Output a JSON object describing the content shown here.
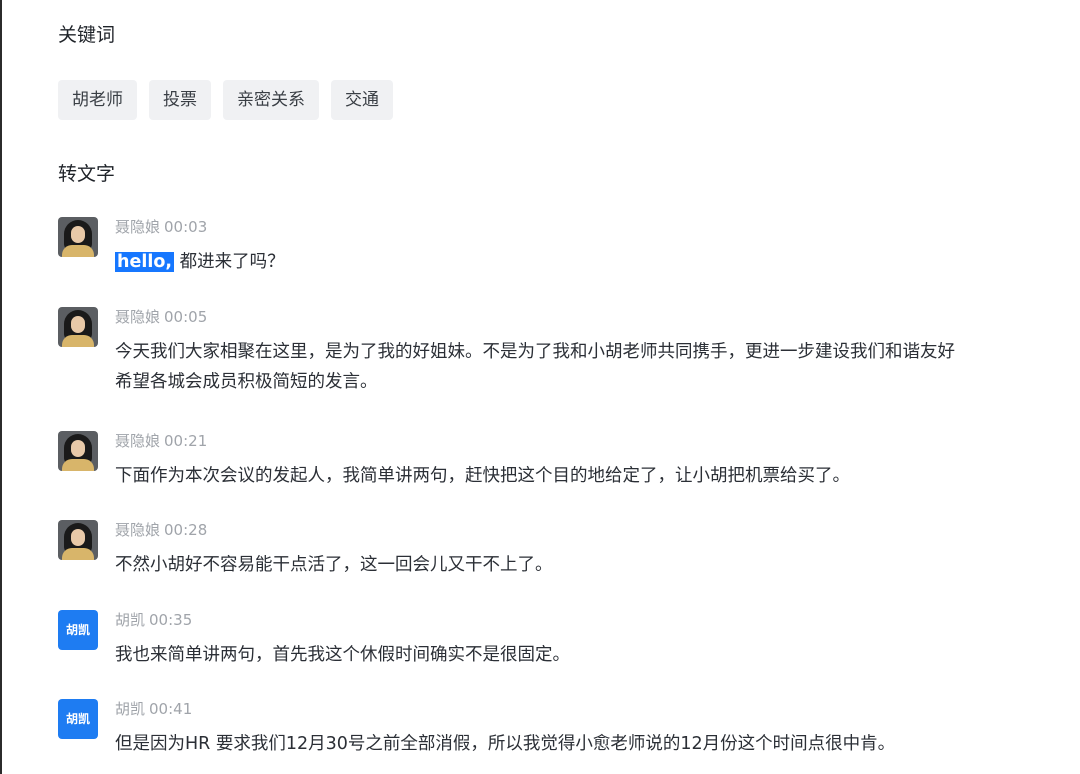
{
  "keywords": {
    "title": "关键词",
    "tags": [
      "胡老师",
      "投票",
      "亲密关系",
      "交通"
    ]
  },
  "transcript": {
    "title": "转文字",
    "messages": [
      {
        "speaker": "聂隐娘",
        "time": "00:03",
        "avatar": "photo",
        "highlight": "hello,",
        "text": "都进来了吗？"
      },
      {
        "speaker": "聂隐娘",
        "time": "00:05",
        "avatar": "photo",
        "line1": "今天我们大家相聚在这里，是为了我的好姐妹。不是为了我和小胡老师共同携手，更进一步建设我们和谐友好",
        "line2": "希望各城会成员积极简短的发言。"
      },
      {
        "speaker": "聂隐娘",
        "time": "00:21",
        "avatar": "photo",
        "text": "下面作为本次会议的发起人，我简单讲两句，赶快把这个目的地给定了，让小胡把机票给买了。"
      },
      {
        "speaker": "聂隐娘",
        "time": "00:28",
        "avatar": "photo",
        "text": "不然小胡好不容易能干点活了，这一回会儿又干不上了。"
      },
      {
        "speaker": "胡凯",
        "time": "00:35",
        "avatar": "text",
        "avatar_text": "胡凯",
        "text": "我也来简单讲两句，首先我这个休假时间确实不是很固定。"
      },
      {
        "speaker": "胡凯",
        "time": "00:41",
        "avatar": "text",
        "avatar_text": "胡凯",
        "text": "但是因为HR 要求我们12月30号之前全部消假，所以我觉得小愈老师说的12月份这个时间点很中肯。"
      }
    ]
  },
  "colors": {
    "highlight": "#1677ff",
    "avatar_blue": "#1e7cf2",
    "tag_bg": "#f0f1f3",
    "meta_text": "#a0a4aa"
  }
}
